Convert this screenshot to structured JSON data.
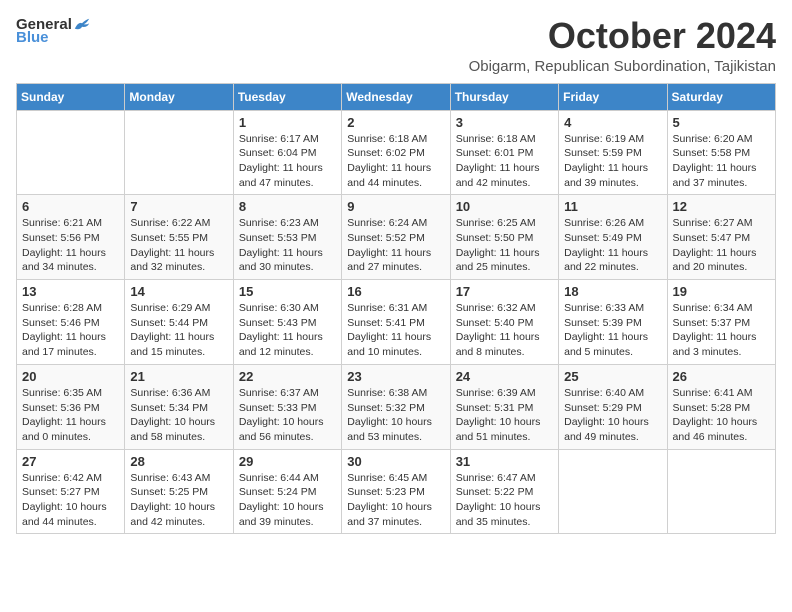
{
  "logo": {
    "general": "General",
    "blue": "Blue"
  },
  "title": "October 2024",
  "subtitle": "Obigarm, Republican Subordination, Tajikistan",
  "days_header": [
    "Sunday",
    "Monday",
    "Tuesday",
    "Wednesday",
    "Thursday",
    "Friday",
    "Saturday"
  ],
  "weeks": [
    [
      {
        "day": "",
        "info": ""
      },
      {
        "day": "",
        "info": ""
      },
      {
        "day": "1",
        "info": "Sunrise: 6:17 AM\nSunset: 6:04 PM\nDaylight: 11 hours and 47 minutes."
      },
      {
        "day": "2",
        "info": "Sunrise: 6:18 AM\nSunset: 6:02 PM\nDaylight: 11 hours and 44 minutes."
      },
      {
        "day": "3",
        "info": "Sunrise: 6:18 AM\nSunset: 6:01 PM\nDaylight: 11 hours and 42 minutes."
      },
      {
        "day": "4",
        "info": "Sunrise: 6:19 AM\nSunset: 5:59 PM\nDaylight: 11 hours and 39 minutes."
      },
      {
        "day": "5",
        "info": "Sunrise: 6:20 AM\nSunset: 5:58 PM\nDaylight: 11 hours and 37 minutes."
      }
    ],
    [
      {
        "day": "6",
        "info": "Sunrise: 6:21 AM\nSunset: 5:56 PM\nDaylight: 11 hours and 34 minutes."
      },
      {
        "day": "7",
        "info": "Sunrise: 6:22 AM\nSunset: 5:55 PM\nDaylight: 11 hours and 32 minutes."
      },
      {
        "day": "8",
        "info": "Sunrise: 6:23 AM\nSunset: 5:53 PM\nDaylight: 11 hours and 30 minutes."
      },
      {
        "day": "9",
        "info": "Sunrise: 6:24 AM\nSunset: 5:52 PM\nDaylight: 11 hours and 27 minutes."
      },
      {
        "day": "10",
        "info": "Sunrise: 6:25 AM\nSunset: 5:50 PM\nDaylight: 11 hours and 25 minutes."
      },
      {
        "day": "11",
        "info": "Sunrise: 6:26 AM\nSunset: 5:49 PM\nDaylight: 11 hours and 22 minutes."
      },
      {
        "day": "12",
        "info": "Sunrise: 6:27 AM\nSunset: 5:47 PM\nDaylight: 11 hours and 20 minutes."
      }
    ],
    [
      {
        "day": "13",
        "info": "Sunrise: 6:28 AM\nSunset: 5:46 PM\nDaylight: 11 hours and 17 minutes."
      },
      {
        "day": "14",
        "info": "Sunrise: 6:29 AM\nSunset: 5:44 PM\nDaylight: 11 hours and 15 minutes."
      },
      {
        "day": "15",
        "info": "Sunrise: 6:30 AM\nSunset: 5:43 PM\nDaylight: 11 hours and 12 minutes."
      },
      {
        "day": "16",
        "info": "Sunrise: 6:31 AM\nSunset: 5:41 PM\nDaylight: 11 hours and 10 minutes."
      },
      {
        "day": "17",
        "info": "Sunrise: 6:32 AM\nSunset: 5:40 PM\nDaylight: 11 hours and 8 minutes."
      },
      {
        "day": "18",
        "info": "Sunrise: 6:33 AM\nSunset: 5:39 PM\nDaylight: 11 hours and 5 minutes."
      },
      {
        "day": "19",
        "info": "Sunrise: 6:34 AM\nSunset: 5:37 PM\nDaylight: 11 hours and 3 minutes."
      }
    ],
    [
      {
        "day": "20",
        "info": "Sunrise: 6:35 AM\nSunset: 5:36 PM\nDaylight: 11 hours and 0 minutes."
      },
      {
        "day": "21",
        "info": "Sunrise: 6:36 AM\nSunset: 5:34 PM\nDaylight: 10 hours and 58 minutes."
      },
      {
        "day": "22",
        "info": "Sunrise: 6:37 AM\nSunset: 5:33 PM\nDaylight: 10 hours and 56 minutes."
      },
      {
        "day": "23",
        "info": "Sunrise: 6:38 AM\nSunset: 5:32 PM\nDaylight: 10 hours and 53 minutes."
      },
      {
        "day": "24",
        "info": "Sunrise: 6:39 AM\nSunset: 5:31 PM\nDaylight: 10 hours and 51 minutes."
      },
      {
        "day": "25",
        "info": "Sunrise: 6:40 AM\nSunset: 5:29 PM\nDaylight: 10 hours and 49 minutes."
      },
      {
        "day": "26",
        "info": "Sunrise: 6:41 AM\nSunset: 5:28 PM\nDaylight: 10 hours and 46 minutes."
      }
    ],
    [
      {
        "day": "27",
        "info": "Sunrise: 6:42 AM\nSunset: 5:27 PM\nDaylight: 10 hours and 44 minutes."
      },
      {
        "day": "28",
        "info": "Sunrise: 6:43 AM\nSunset: 5:25 PM\nDaylight: 10 hours and 42 minutes."
      },
      {
        "day": "29",
        "info": "Sunrise: 6:44 AM\nSunset: 5:24 PM\nDaylight: 10 hours and 39 minutes."
      },
      {
        "day": "30",
        "info": "Sunrise: 6:45 AM\nSunset: 5:23 PM\nDaylight: 10 hours and 37 minutes."
      },
      {
        "day": "31",
        "info": "Sunrise: 6:47 AM\nSunset: 5:22 PM\nDaylight: 10 hours and 35 minutes."
      },
      {
        "day": "",
        "info": ""
      },
      {
        "day": "",
        "info": ""
      }
    ]
  ]
}
